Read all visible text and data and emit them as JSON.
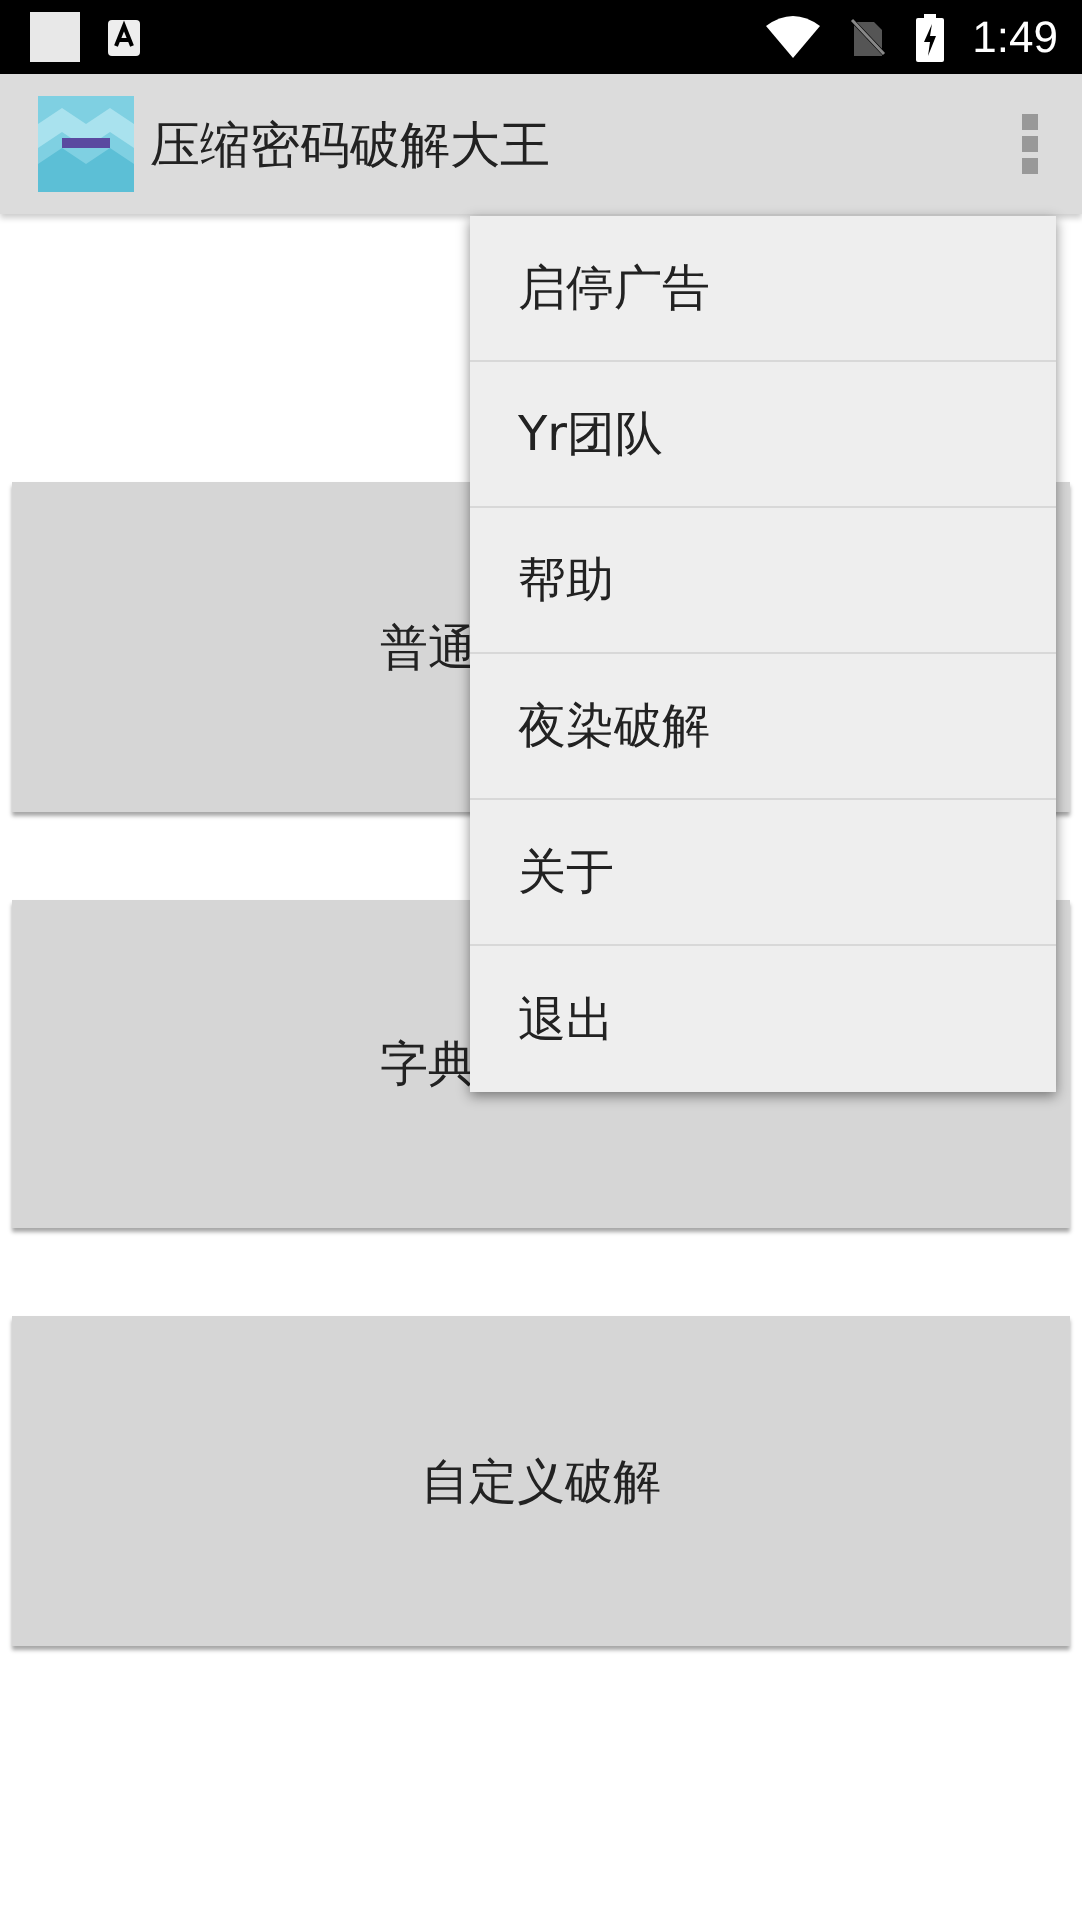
{
  "status_bar": {
    "time": "1:49"
  },
  "app_bar": {
    "title": "压缩密码破解大王"
  },
  "buttons": [
    {
      "label": "普通",
      "kind": "covered"
    },
    {
      "label": "字典",
      "kind": "covered"
    },
    {
      "label": "自定义破解",
      "kind": "full"
    }
  ],
  "menu": {
    "items": [
      "启停广告",
      "Yr团队",
      "帮助",
      "夜染破解",
      "关于",
      "退出"
    ]
  }
}
